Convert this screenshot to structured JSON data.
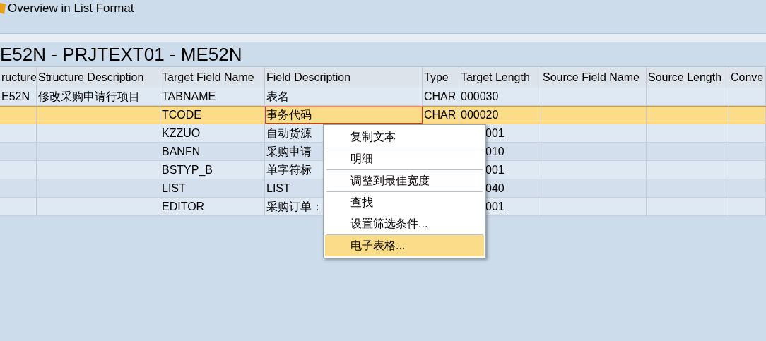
{
  "window": {
    "title": "Overview in List Format"
  },
  "heading": "E52N - PRJTEXT01 - ME52N",
  "table": {
    "columns": [
      "ructure",
      "Structure Description",
      "Target Field Name",
      "Field Description",
      "Type",
      "Target Length",
      "Source Field Name",
      "Source Length",
      "Conve"
    ],
    "rows": [
      {
        "selected": false,
        "cells": [
          "E52N",
          "修改采购申请行项目",
          "TABNAME",
          "表名",
          "CHAR",
          "000030",
          "",
          "",
          ""
        ]
      },
      {
        "selected": true,
        "cells": [
          "",
          "",
          "TCODE",
          "事务代码",
          "CHAR",
          "000020",
          "",
          "",
          ""
        ]
      },
      {
        "selected": false,
        "cells": [
          "",
          "",
          "KZZUO",
          "自动货源",
          "",
          "001",
          "",
          "",
          ""
        ]
      },
      {
        "selected": false,
        "cells": [
          "",
          "",
          "BANFN",
          "采购申请",
          "",
          "010",
          "",
          "",
          ""
        ]
      },
      {
        "selected": false,
        "cells": [
          "",
          "",
          "BSTYP_B",
          "单字符标",
          "",
          "001",
          "",
          "",
          ""
        ]
      },
      {
        "selected": false,
        "cells": [
          "",
          "",
          "LIST",
          "LIST",
          "",
          "040",
          "",
          "",
          ""
        ]
      },
      {
        "selected": false,
        "cells": [
          "",
          "",
          "EDITOR",
          "采购订单：",
          "",
          "001",
          "",
          "",
          ""
        ]
      }
    ]
  },
  "context_menu": {
    "items": [
      {
        "label": "复制文本",
        "selected": false
      },
      {
        "label": "明细",
        "selected": false
      },
      {
        "label": "调整到最佳宽度",
        "selected": false
      },
      {
        "label": "查找",
        "selected": false
      },
      {
        "label": "设置筛选条件...",
        "selected": false
      },
      {
        "label": "电子表格...",
        "selected": true
      }
    ]
  }
}
